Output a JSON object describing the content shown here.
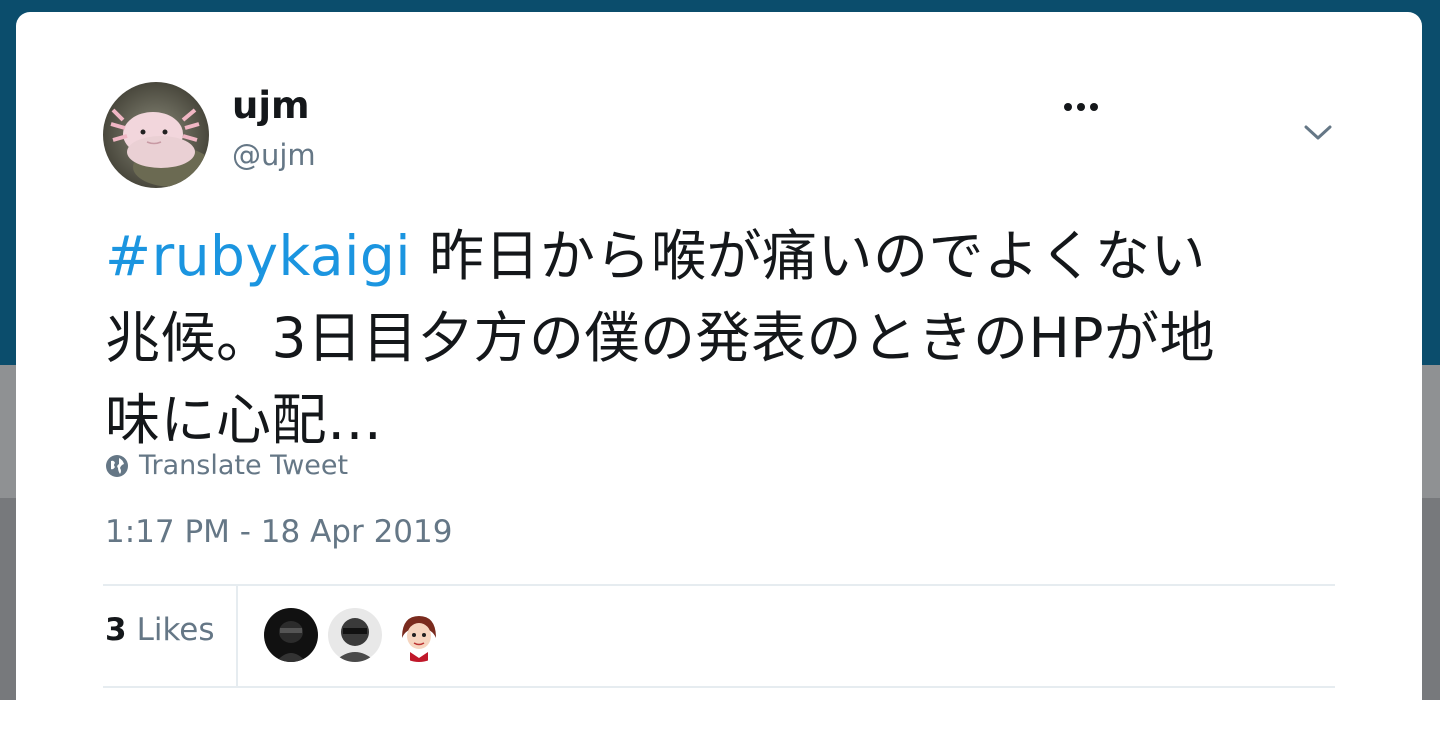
{
  "author": {
    "display_name": "ujm",
    "handle": "@ujm"
  },
  "tweet": {
    "hashtag": "#rubykaigi",
    "line1": " 昨日から喉が痛いのでよくない",
    "line2": "兆候。3日目夕方の僕の発表のときのHPが地",
    "line3": "味に心配…"
  },
  "translate_label": "Translate Tweet",
  "timestamp": "1:17 PM - 18 Apr 2019",
  "likes": {
    "count": "3",
    "label": "Likes"
  },
  "icons": {
    "more": "more-horizontal-icon",
    "caret": "chevron-down-icon",
    "globe": "globe-icon"
  },
  "colors": {
    "link": "#1b95e0",
    "text": "#14171a",
    "secondary": "#657786",
    "header_bg": "#0b4d6c"
  }
}
